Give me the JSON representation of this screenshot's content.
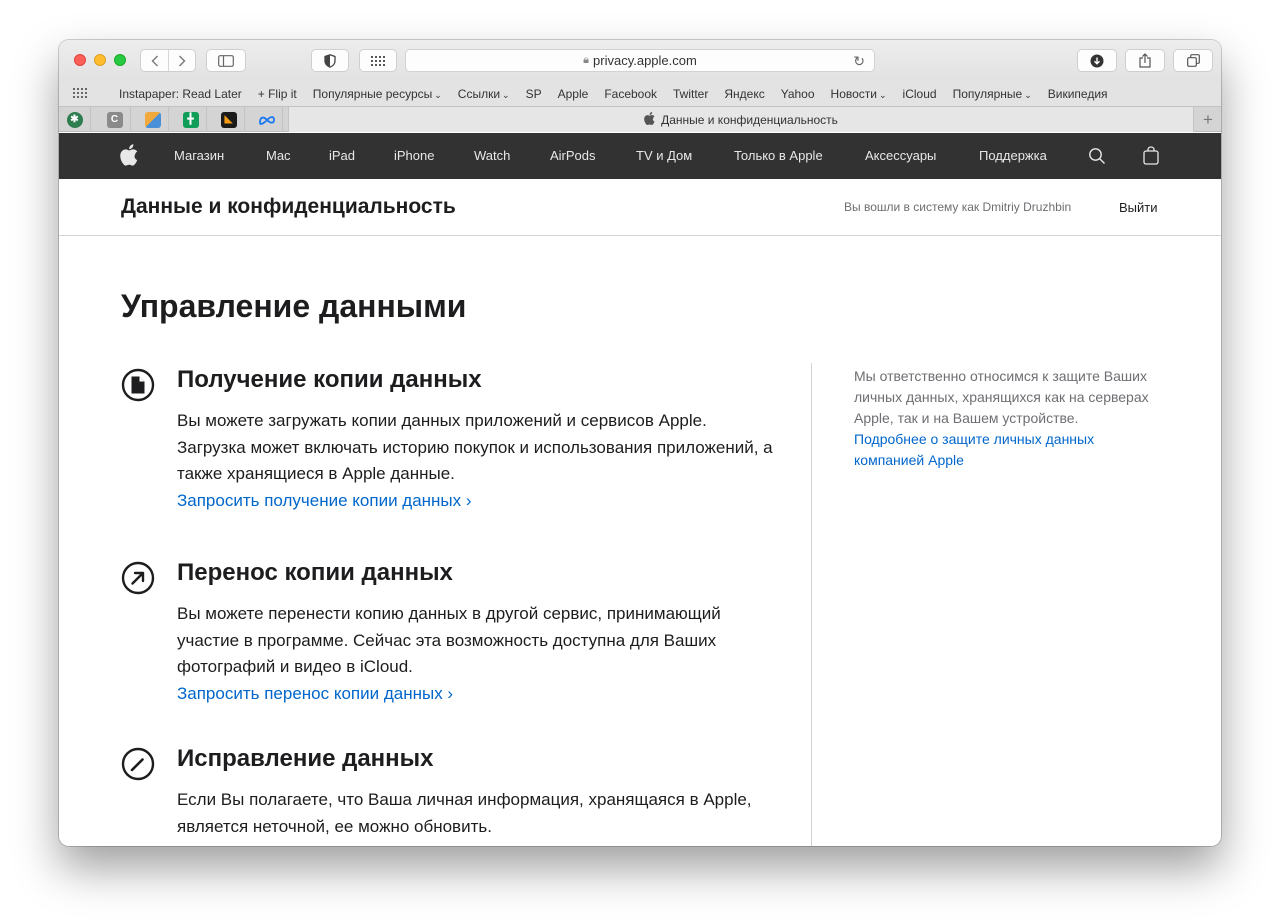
{
  "browser": {
    "url": "privacy.apple.com",
    "tab_title": "Данные и конфиденциальность",
    "bookmarks": [
      {
        "label": "Instapaper: Read Later",
        "dropdown": false
      },
      {
        "label": "+ Flip it",
        "dropdown": false
      },
      {
        "label": "Популярные ресурсы",
        "dropdown": true
      },
      {
        "label": "Ссылки",
        "dropdown": true
      },
      {
        "label": "SP",
        "dropdown": false
      },
      {
        "label": "Apple",
        "dropdown": false
      },
      {
        "label": "Facebook",
        "dropdown": false
      },
      {
        "label": "Twitter",
        "dropdown": false
      },
      {
        "label": "Яндекс",
        "dropdown": false
      },
      {
        "label": "Yahoo",
        "dropdown": false
      },
      {
        "label": "Новости",
        "dropdown": true
      },
      {
        "label": "iCloud",
        "dropdown": false
      },
      {
        "label": "Популярные",
        "dropdown": true
      },
      {
        "label": "Википедия",
        "dropdown": false
      }
    ]
  },
  "globalnav": {
    "items": [
      "Магазин",
      "Mac",
      "iPad",
      "iPhone",
      "Watch",
      "AirPods",
      "TV и Дом",
      "Только в Apple",
      "Аксессуары",
      "Поддержка"
    ]
  },
  "localnav": {
    "title": "Данные и конфиденциальность",
    "signed_in": "Вы вошли в систему как Dmitriy Druzhbin",
    "logout": "Выйти"
  },
  "main": {
    "heading": "Управление данными",
    "sections": [
      {
        "icon": "document-icon",
        "title": "Получение копии данных",
        "body": "Вы можете загружать копии данных приложений и сервисов Apple. Загрузка может включать историю покупок и использования приложений, а также хранящиеся в Apple данные.",
        "link": "Запросить получение копии данных ›"
      },
      {
        "icon": "arrow-up-right-icon",
        "title": "Перенос копии данных",
        "body": "Вы можете перенести копию данных в другой сервис, принимающий участие в программе. Сейчас эта возможность доступна для Ваших фотографий и видео в iCloud.",
        "link": "Запросить перенос копии данных ›"
      },
      {
        "icon": "pencil-icon",
        "title": "Исправление данных",
        "body": "Если Вы полагаете, что Ваша личная информация, хранящаяся в Apple, является неточной, ее можно обновить.",
        "link": ""
      }
    ],
    "aside": {
      "text": "Мы ответственно относимся к защите Ваших личных данных, хранящихся как на серверах Apple, так и на Вашем устройстве.",
      "link": "Подробнее о защите личных данных компанией Apple"
    }
  }
}
